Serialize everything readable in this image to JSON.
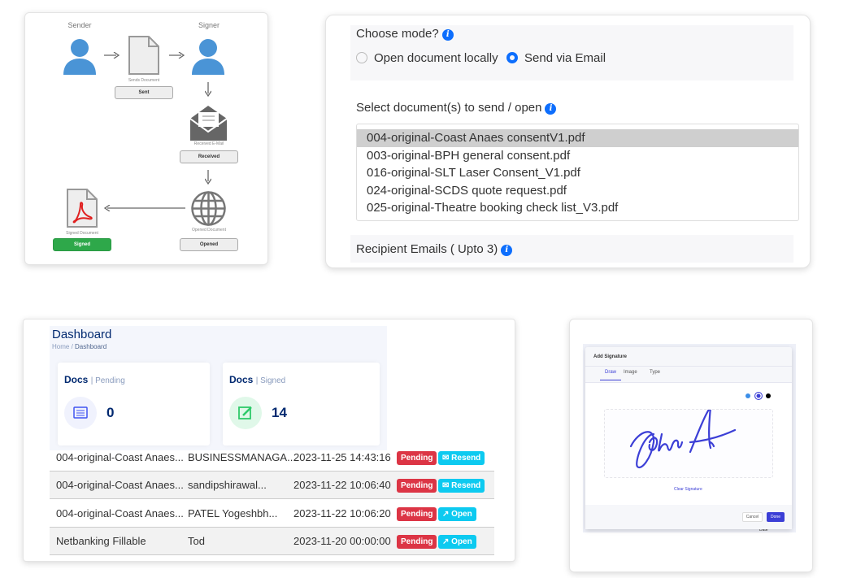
{
  "flow": {
    "sender": "Sender",
    "signer": "Signer",
    "sends_document": "Sends Document",
    "sent": "Sent",
    "received_email": "Received E-Mail",
    "received": "Received",
    "opened_document": "Opened Document",
    "opened": "Opened",
    "signed_document": "Signed Document",
    "signed": "Signed"
  },
  "mode": {
    "title": "Choose mode?",
    "options": [
      {
        "label": "Open document locally",
        "selected": false
      },
      {
        "label": "Send via Email",
        "selected": true
      }
    ],
    "select_docs_label": "Select document(s) to send / open",
    "documents": [
      "004-original-Coast Anaes consentV1.pdf",
      "003-original-BPH general consent.pdf",
      "016-original-SLT Laser Consent_V1.pdf",
      "024-original-SCDS quote request.pdf",
      "025-original-Theatre booking check list_V3.pdf"
    ],
    "selected_document": "004-original-Coast Anaes consentV1.pdf",
    "recipients_label": "Recipient Emails ( Upto 3)"
  },
  "dashboard": {
    "title": "Dashboard",
    "breadcrumb": [
      "Home",
      "Dashboard"
    ],
    "cards": [
      {
        "title": "Docs",
        "sub": "| Pending",
        "value": "0"
      },
      {
        "title": "Docs",
        "sub": "| Signed",
        "value": "14"
      }
    ],
    "rows": [
      {
        "name": "004-original-Coast Anaes...",
        "recipient": "BUSINESSMANAGA...",
        "date": "2023-11-25 14:43:16",
        "status": "Pending",
        "action": "Resend"
      },
      {
        "name": "004-original-Coast Anaes...",
        "recipient": "sandipshirawal...",
        "date": "2023-11-22 10:06:40",
        "status": "Pending",
        "action": "Resend"
      },
      {
        "name": "004-original-Coast Anaes...",
        "recipient": "PATEL Yogeshbh...",
        "date": "2023-11-22 10:06:20",
        "status": "Pending",
        "action": "Open"
      },
      {
        "name": "Netbanking Fillable",
        "recipient": "Tod",
        "date": "2023-11-20 00:00:00",
        "status": "Pending",
        "action": "Open"
      }
    ]
  },
  "signature": {
    "title": "Add Signature",
    "tabs": [
      "Draw",
      "Image",
      "Type"
    ],
    "active_tab": "Draw",
    "colors": [
      "#3b8ee8",
      "#3c3fd6",
      "#000000"
    ],
    "selected_color": "#3c3fd6",
    "clear": "Clear Signature",
    "cancel": "Cancel",
    "done": "Done",
    "bg_text": "Date"
  }
}
